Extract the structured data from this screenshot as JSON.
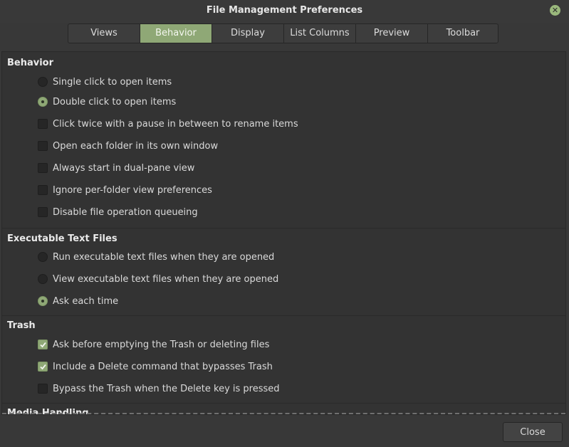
{
  "window": {
    "title": "File Management Preferences",
    "close_icon": "close-icon"
  },
  "tabs": [
    {
      "label": "Views"
    },
    {
      "label": "Behavior",
      "active": true
    },
    {
      "label": "Display"
    },
    {
      "label": "List Columns"
    },
    {
      "label": "Preview"
    },
    {
      "label": "Toolbar"
    }
  ],
  "behavior": {
    "title": "Behavior",
    "single_click": "Single click to open items",
    "double_click": "Double click to open items",
    "click_twice": "Click twice with a pause in between to rename items",
    "own_window": "Open each folder in its own window",
    "dual_pane": "Always start in dual-pane view",
    "ignore_prefs": "Ignore per-folder view preferences",
    "disable_queue": "Disable file operation queueing"
  },
  "executable": {
    "title": "Executable Text Files",
    "run": "Run executable text files when they are opened",
    "view": "View executable text files when they are opened",
    "ask": "Ask each time"
  },
  "trash": {
    "title": "Trash",
    "ask_before": "Ask before emptying the Trash or deleting files",
    "include_delete": "Include a Delete command that bypasses Trash",
    "bypass": "Bypass the Trash when the Delete key is pressed"
  },
  "media": {
    "title": "Media Handling"
  },
  "footer": {
    "close_label": "Close"
  },
  "colors": {
    "accent": "#8fa876",
    "background": "#383838",
    "panel": "#333333"
  }
}
